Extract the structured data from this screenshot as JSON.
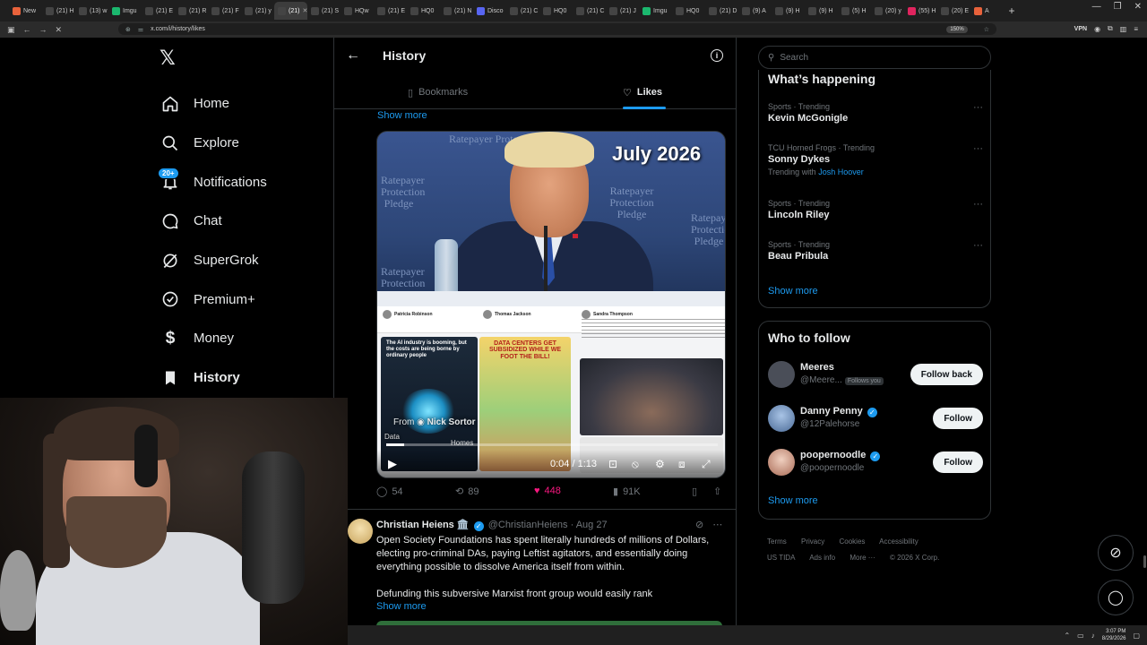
{
  "browser": {
    "tabs": [
      {
        "label": "New",
        "color": "#e8623b"
      },
      {
        "label": "(21) H",
        "color": "#444"
      },
      {
        "label": "(13) w",
        "color": "#444"
      },
      {
        "label": "Imgu",
        "color": "#1bb76e"
      },
      {
        "label": "(21) E",
        "color": "#444"
      },
      {
        "label": "(21) R",
        "color": "#444"
      },
      {
        "label": "(21) F",
        "color": "#444"
      },
      {
        "label": "(21) y",
        "color": "#444"
      },
      {
        "label": "(21)",
        "color": "#444",
        "active": true
      },
      {
        "label": "(21) S",
        "color": "#444"
      },
      {
        "label": "HQw",
        "color": "#444"
      },
      {
        "label": "(21) E",
        "color": "#444"
      },
      {
        "label": "HQ0",
        "color": "#444"
      },
      {
        "label": "(21) N",
        "color": "#444"
      },
      {
        "label": "Disco",
        "color": "#5865f2"
      },
      {
        "label": "(21) C",
        "color": "#444"
      },
      {
        "label": "HQ0",
        "color": "#444"
      },
      {
        "label": "(21) C",
        "color": "#444"
      },
      {
        "label": "(21) J",
        "color": "#444"
      },
      {
        "label": "Imgu",
        "color": "#1bb76e"
      },
      {
        "label": "HQ0",
        "color": "#444"
      },
      {
        "label": "(21) D",
        "color": "#444"
      },
      {
        "label": "(9) A",
        "color": "#444"
      },
      {
        "label": "(9) H",
        "color": "#444"
      },
      {
        "label": "(9) H",
        "color": "#444"
      },
      {
        "label": "(5) H",
        "color": "#444"
      },
      {
        "label": "(20) y",
        "color": "#444"
      },
      {
        "label": "(55) H",
        "color": "#e0245e"
      },
      {
        "label": "(20) E",
        "color": "#444"
      },
      {
        "label": "A",
        "color": "#e8623b"
      }
    ],
    "new_tab": "+",
    "url": "x.com/i/history/likes",
    "zoom": "150%",
    "vpn": "VPN"
  },
  "nav": {
    "logo": "𝕏",
    "items": [
      {
        "key": "home",
        "label": "Home"
      },
      {
        "key": "explore",
        "label": "Explore"
      },
      {
        "key": "notifications",
        "label": "Notifications",
        "badge": "20+"
      },
      {
        "key": "chat",
        "label": "Chat"
      },
      {
        "key": "supergrok",
        "label": "SuperGrok"
      },
      {
        "key": "premium",
        "label": "Premium+"
      },
      {
        "key": "money",
        "label": "Money"
      },
      {
        "key": "history",
        "label": "History",
        "active": true
      }
    ]
  },
  "header": {
    "title": "History",
    "tabs": [
      {
        "label": "Bookmarks"
      },
      {
        "label": "Likes",
        "active": true
      }
    ]
  },
  "feed": {
    "show_more_top": "Show more",
    "video": {
      "date_stamp": "July 2026",
      "pledge_text": "Ratepayer Protection Pledge",
      "panel_ai_caption": "The AI industry is booming, but the costs are being borne by ordinary people",
      "panel_comic_title": "DATA CENTERS GET SUBSIDIZED WHILE WE FOOT THE BILL!",
      "bp_users": [
        "Patricia Robinson",
        "Thomas Jackson",
        "Sandra Thompson"
      ],
      "from_prefix": "From",
      "from_name": "Nick Sortor",
      "scrub_left": "Data",
      "scrub_right": "Homes",
      "time": "0:04 / 1:13",
      "progress": 0.055
    },
    "actions": {
      "replies": "54",
      "reposts": "89",
      "likes": "448",
      "views": "91K"
    },
    "post2": {
      "name": "Christian Heiens",
      "name_emoji": "🏛️",
      "handle": "@ChristianHeiens",
      "date": "Aug 27",
      "body_1": "Open Society Foundations has spent literally hundreds of millions of Dollars, electing pro-criminal DAs, paying Leftist agitators, and essentially doing everything possible to dissolve America itself from within.",
      "body_2": "Defunding this subversive Marxist front group would easily rank",
      "show_more": "Show more"
    }
  },
  "right": {
    "search_placeholder": "Search",
    "whats_happening": {
      "title": "What’s happening",
      "trends": [
        {
          "category": "Sports · Trending",
          "name": "Kevin McGonigle"
        },
        {
          "category": "TCU Horned Frogs · Trending",
          "name": "Sonny Dykes",
          "with_prefix": "Trending with",
          "with_name": "Josh Hoover"
        },
        {
          "category": "Sports · Trending",
          "name": "Lincoln Riley"
        },
        {
          "category": "Sports · Trending",
          "name": "Beau Pribula"
        }
      ],
      "show_more": "Show more"
    },
    "who_to_follow": {
      "title": "Who to follow",
      "accounts": [
        {
          "name": "Meeres",
          "handle": "@Meere...",
          "follows_you": "Follows you",
          "button": "Follow back",
          "verified": false,
          "avatar_color": "#4a4e58"
        },
        {
          "name": "Danny Penny",
          "handle": "@12Palehorse",
          "button": "Follow",
          "verified": true,
          "avatar_color": "#6a89b5"
        },
        {
          "name": "poopernoodle",
          "handle": "@poopernoodle",
          "button": "Follow",
          "verified": true,
          "avatar_color": "#c7917a"
        }
      ],
      "show_more": "Show more"
    },
    "footer": {
      "links_row1": [
        "Terms",
        "Privacy",
        "Cookies",
        "Accessibility"
      ],
      "links_row2": [
        "US TIDA",
        "Ads info",
        "More ···",
        "© 2026 X Corp."
      ]
    }
  },
  "taskbar": {
    "time": "3:07 PM",
    "date": "8/29/2026"
  }
}
